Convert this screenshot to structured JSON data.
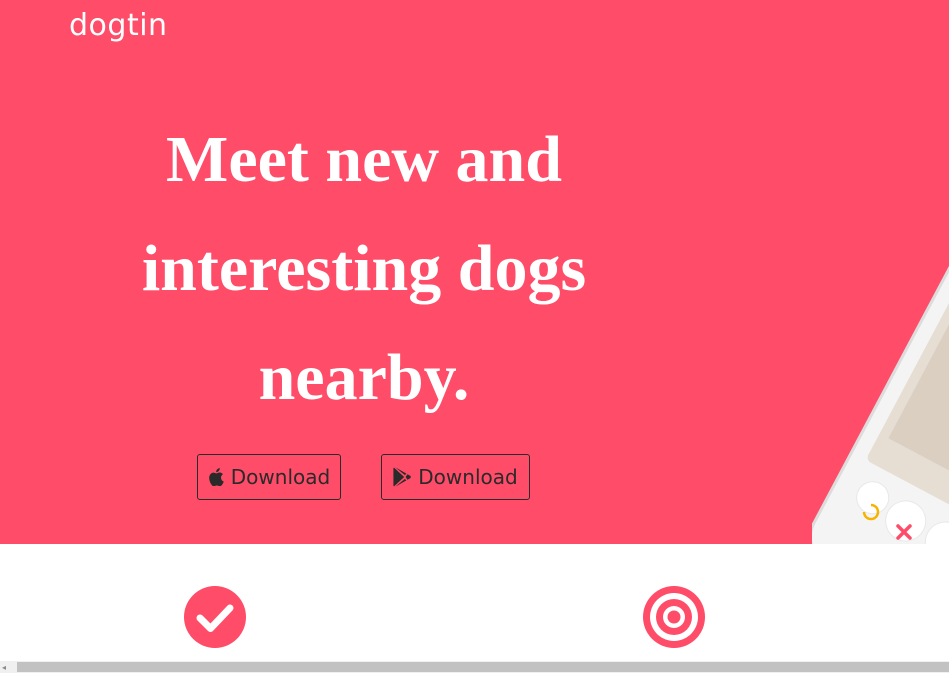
{
  "brand": {
    "name": "dogtin"
  },
  "hero": {
    "headline_lines": [
      "Meet new and",
      "interesting dogs",
      "nearby."
    ],
    "buttons": [
      {
        "label": "Download",
        "icon": "apple-icon"
      },
      {
        "label": "Download",
        "icon": "google-play-icon"
      }
    ],
    "background_color": "#ff4c68"
  },
  "features": [
    {
      "icon": "check-circle-icon"
    },
    {
      "icon": "target-icon"
    }
  ],
  "colors": {
    "accent": "#ff4c68",
    "text_on_accent": "#ffffff",
    "button_border": "#2a2a2a"
  },
  "scrollbar": {
    "arrow_left": "◂"
  }
}
